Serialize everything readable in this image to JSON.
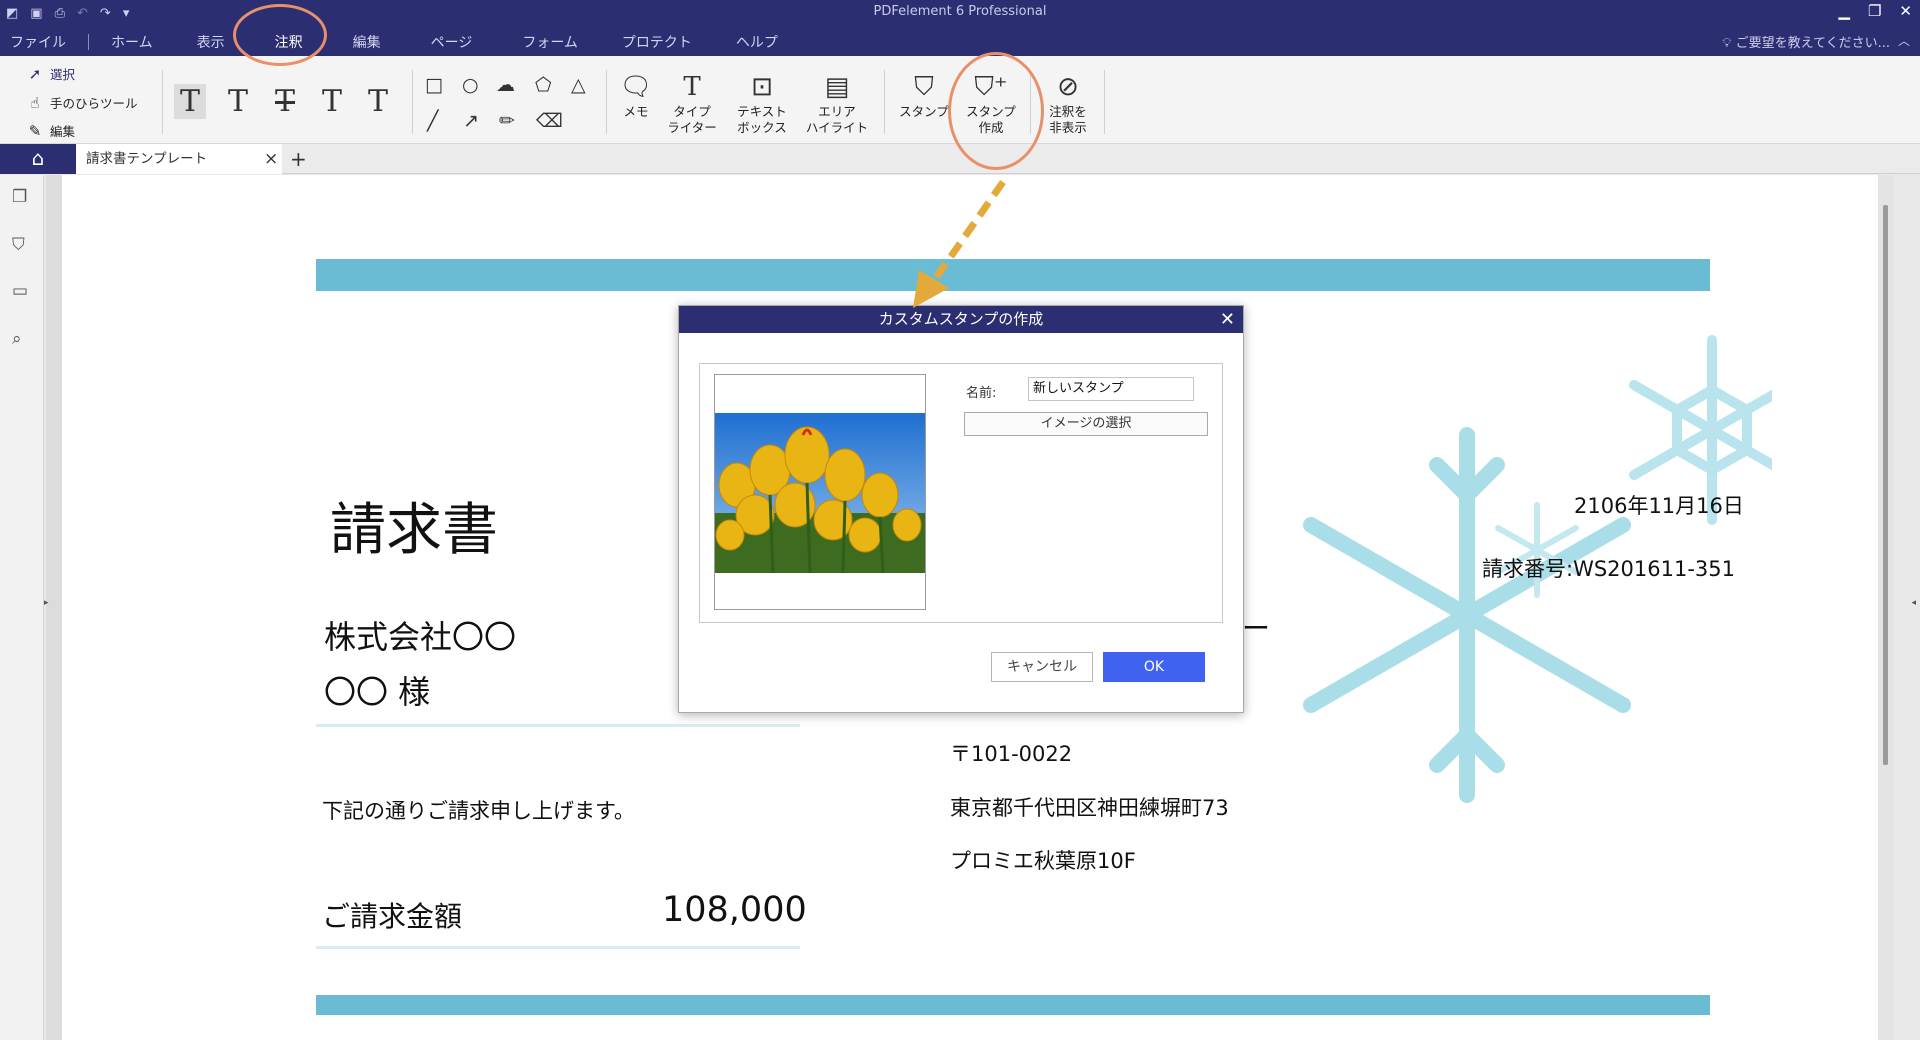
{
  "app_title": "PDFelement 6 Professional",
  "menu": [
    "ファイル",
    "ホーム",
    "表示",
    "注釈",
    "編集",
    "ページ",
    "フォーム",
    "プロテクト",
    "ヘルプ"
  ],
  "menu_active": "注釈",
  "help_text": "ご要望を教えてください...",
  "tools": {
    "select": "選択",
    "hand": "手のひらツール",
    "edit": "編集"
  },
  "ribbon": {
    "memo": "メモ",
    "typewriter": [
      "タイプ",
      "ライター"
    ],
    "textbox": [
      "テキスト",
      "ボックス"
    ],
    "area": [
      "エリア",
      "ハイライト"
    ],
    "stamp": "スタンプ",
    "stamp_create": [
      "スタンプ",
      "作成"
    ],
    "hide": [
      "注釈を",
      "非表示"
    ]
  },
  "tab": {
    "doc": "請求書テンプレート"
  },
  "document": {
    "title": "請求書",
    "date": "2106年11月16日",
    "invoice_no": "請求番号:WS201611-351",
    "customer": "株式会社〇〇",
    "customer_sama": "〇〇 様",
    "dash": "ー",
    "message": "下記の通りご請求申し上げます。",
    "postal": "〒101-0022",
    "address": "東京都千代田区神田練塀町73",
    "building": "プロミエ秋葉原10F",
    "amount_label": "ご請求金額",
    "amount": "108,000"
  },
  "dialog": {
    "title": "カスタムスタンプの作成",
    "name_label": "名前:",
    "name_value": "新しいスタンプ",
    "select_image": "イメージの選択",
    "cancel": "キャンセル",
    "ok": "OK"
  },
  "colors": {
    "titlebar": "#2c2e72",
    "accent_band": "#69bcd4",
    "ok_button": "#3f62f0",
    "annotation": "#e8906a",
    "arrow": "#e3a93a"
  }
}
